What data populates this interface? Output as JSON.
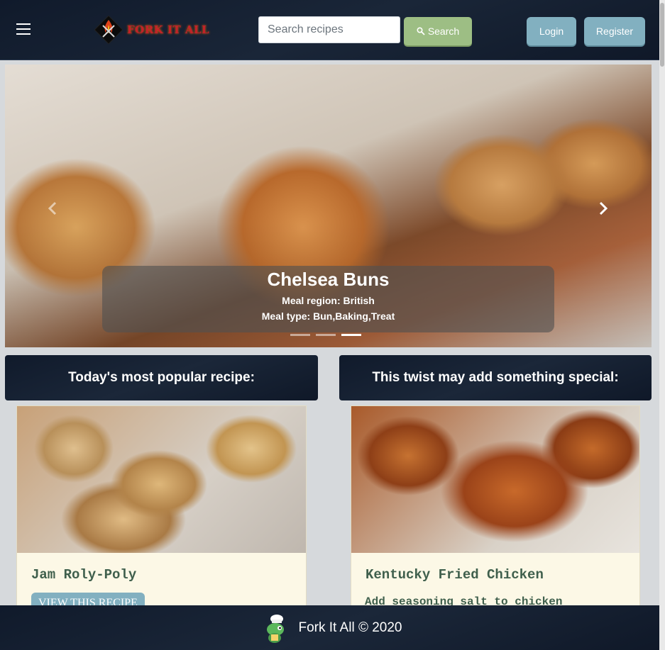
{
  "navbar": {
    "menu_icon": "hamburger-menu-icon",
    "brand_name": "FORK IT ALL",
    "search": {
      "placeholder": "Search recipes",
      "value": "",
      "button_label": "Search",
      "button_icon": "magnifier-icon"
    },
    "login_label": "Login",
    "register_label": "Register"
  },
  "carousel": {
    "title": "Chelsea Buns",
    "region_line": "Meal region: British",
    "type_line": "Meal type: Bun,Baking,Treat",
    "prev_icon": "chevron-left-icon",
    "next_icon": "chevron-right-icon",
    "active_slide": 3,
    "slide_count": 3
  },
  "sections": {
    "popular_heading": "Today's most popular recipe:",
    "twist_heading": "This twist may add something special:"
  },
  "cards": {
    "popular": {
      "title": "Jam Roly-Poly",
      "button_label": "VIEW THIS RECIPE"
    },
    "twist": {
      "title": "Kentucky Fried Chicken",
      "text": "Add seasoning salt to chicken"
    }
  },
  "footer": {
    "text": "Fork It All © 2020",
    "mascot_icon": "chef-dinosaur-icon"
  },
  "colors": {
    "navbar": "#101a2b",
    "search_button": "#9dbe84",
    "nav_button": "#82b0c0",
    "card_bg": "#fcf8e6",
    "card_text": "#3f5f4c",
    "brand_red": "#c4202a"
  }
}
